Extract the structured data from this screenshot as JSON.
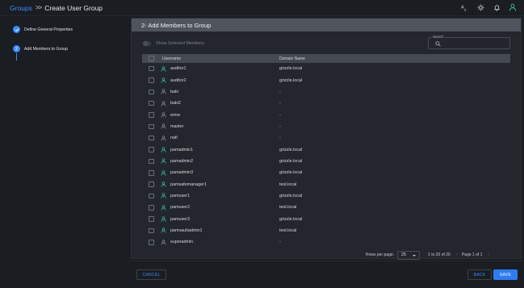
{
  "header": {
    "breadcrumb_parent": "Groups",
    "breadcrumb_separator": ">>",
    "breadcrumb_current": "Create User Group",
    "icons": [
      "translate-icon",
      "theme-icon",
      "bell-icon",
      "user-icon"
    ]
  },
  "stepper": {
    "steps": [
      {
        "label": "Define General Properties",
        "state": "completed",
        "number": ""
      },
      {
        "label": "Add Members to Group",
        "state": "active",
        "number": "2"
      }
    ]
  },
  "panel": {
    "title": "2- Add Members to Group",
    "toggle_label": "Show Selected Members",
    "search": {
      "label": "Search",
      "value": ""
    },
    "columns": {
      "username": "Username",
      "domain": "Domain Name"
    },
    "rows": [
      {
        "username": "auditor1",
        "domain": "grizzle.local",
        "icon_color": "#3fbfa8"
      },
      {
        "username": "auditor2",
        "domain": "grizzle.local",
        "icon_color": "#3fbfa8"
      },
      {
        "username": "baki",
        "domain": "-",
        "icon_color": "#8b9097"
      },
      {
        "username": "baki2",
        "domain": "-",
        "icon_color": "#8b9097"
      },
      {
        "username": "emre",
        "domain": "-",
        "icon_color": "#8b9097"
      },
      {
        "username": "master",
        "domain": "-",
        "icon_color": "#8b9097"
      },
      {
        "username": "nafi",
        "domain": "-",
        "icon_color": "#8b9097"
      },
      {
        "username": "pamadmin1",
        "domain": "grizzle.local",
        "icon_color": "#3fbfa8"
      },
      {
        "username": "pamadmin2",
        "domain": "grizzle.local",
        "icon_color": "#3fbfa8"
      },
      {
        "username": "pamadmin3",
        "domain": "grizzle.local",
        "icon_color": "#3fbfa8"
      },
      {
        "username": "pamsafemanager1",
        "domain": "test.local",
        "icon_color": "#3fbfa8"
      },
      {
        "username": "pamuser1",
        "domain": "grizzle.local",
        "icon_color": "#3fbfa8"
      },
      {
        "username": "pamuser2",
        "domain": "test.local",
        "icon_color": "#3fbfa8"
      },
      {
        "username": "pamuser3",
        "domain": "grizzle.local",
        "icon_color": "#3fbfa8"
      },
      {
        "username": "pamvaultadmin1",
        "domain": "test.local",
        "icon_color": "#3fbfa8"
      },
      {
        "username": "superadmin",
        "domain": "-",
        "icon_color": "#8b9097"
      }
    ],
    "pagination": {
      "rows_per_page_label": "Rows per page:",
      "rows_per_page_value": "25",
      "range": "1 to 20 of 20",
      "page": "Page 1 of 1"
    }
  },
  "footer": {
    "cancel_label": "CANCEL",
    "back_label": "BACK",
    "save_label": "SAVE"
  },
  "colors": {
    "accent": "#3b8cff",
    "domain_user_icon": "#3fbfa8",
    "local_user_icon": "#8b9097"
  }
}
